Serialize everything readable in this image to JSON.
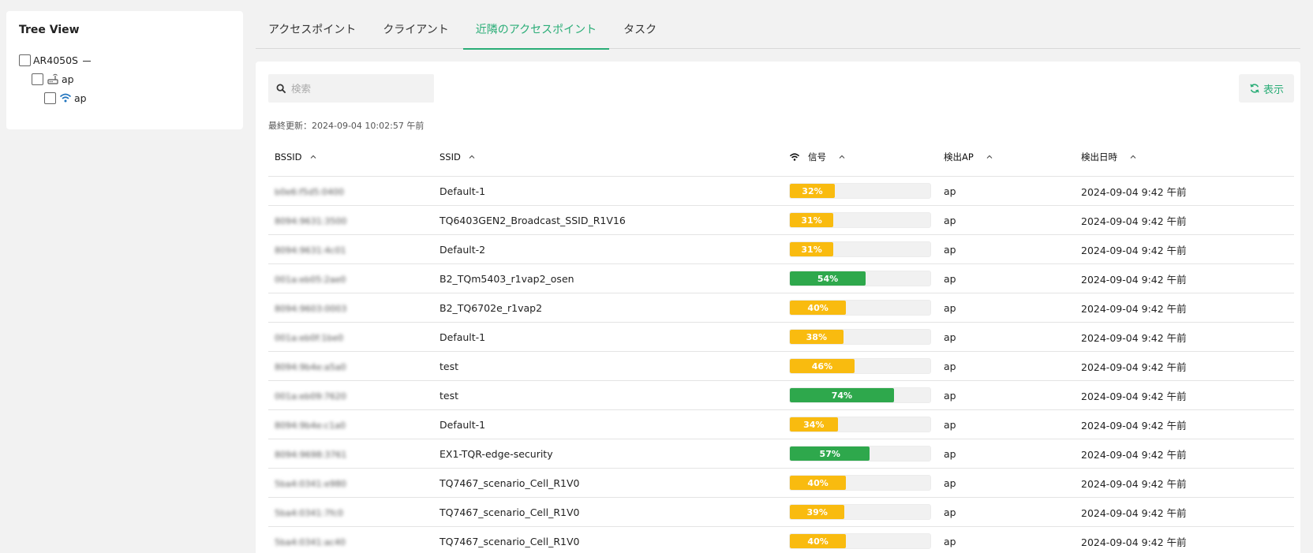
{
  "tree": {
    "title": "Tree View",
    "root_label": "AR4050S",
    "child_label": "ap",
    "leaf_label": "ap"
  },
  "tabs": [
    {
      "label": "アクセスポイント",
      "active": false
    },
    {
      "label": "クライアント",
      "active": false
    },
    {
      "label": "近隣のアクセスポイント",
      "active": true
    },
    {
      "label": "タスク",
      "active": false
    }
  ],
  "search": {
    "placeholder": "検索",
    "value": ""
  },
  "refresh_button": {
    "label": "表示"
  },
  "last_updated": "最終更新：2024-09-04 10:02:57 午前",
  "table": {
    "headers": {
      "bssid": "BSSID",
      "ssid": "SSID",
      "signal": "信号",
      "detected_ap": "検出AP",
      "detected_time": "検出日時"
    },
    "rows": [
      {
        "bssid": "b0e6:f5d5:0400",
        "ssid": "Default-1",
        "signal": 32,
        "signal_label": "32%",
        "ap": "ap",
        "time": "2024-09-04 9:42 午前"
      },
      {
        "bssid": "8094:9631:3500",
        "ssid": "TQ6403GEN2_Broadcast_SSID_R1V16",
        "signal": 31,
        "signal_label": "31%",
        "ap": "ap",
        "time": "2024-09-04 9:42 午前"
      },
      {
        "bssid": "8094:9631:4c01",
        "ssid": "Default-2",
        "signal": 31,
        "signal_label": "31%",
        "ap": "ap",
        "time": "2024-09-04 9:42 午前"
      },
      {
        "bssid": "001a:eb05:2ae0",
        "ssid": "B2_TQm5403_r1vap2_osen",
        "signal": 54,
        "signal_label": "54%",
        "ap": "ap",
        "time": "2024-09-04 9:42 午前"
      },
      {
        "bssid": "8094:9603:0003",
        "ssid": "B2_TQ6702e_r1vap2",
        "signal": 40,
        "signal_label": "40%",
        "ap": "ap",
        "time": "2024-09-04 9:42 午前"
      },
      {
        "bssid": "001a:eb0f:1be0",
        "ssid": "Default-1",
        "signal": 38,
        "signal_label": "38%",
        "ap": "ap",
        "time": "2024-09-04 9:42 午前"
      },
      {
        "bssid": "8094:9b4e:a5a0",
        "ssid": "test",
        "signal": 46,
        "signal_label": "46%",
        "ap": "ap",
        "time": "2024-09-04 9:42 午前"
      },
      {
        "bssid": "001a:eb09:7620",
        "ssid": "test",
        "signal": 74,
        "signal_label": "74%",
        "ap": "ap",
        "time": "2024-09-04 9:42 午前"
      },
      {
        "bssid": "8094:9b4e:c1a0",
        "ssid": "Default-1",
        "signal": 34,
        "signal_label": "34%",
        "ap": "ap",
        "time": "2024-09-04 9:42 午前"
      },
      {
        "bssid": "8094:9698:3761",
        "ssid": "EX1-TQR-edge-security",
        "signal": 57,
        "signal_label": "57%",
        "ap": "ap",
        "time": "2024-09-04 9:42 午前"
      },
      {
        "bssid": "5ba4:0341:e980",
        "ssid": "TQ7467_scenario_Cell_R1V0",
        "signal": 40,
        "signal_label": "40%",
        "ap": "ap",
        "time": "2024-09-04 9:42 午前"
      },
      {
        "bssid": "5ba4:0341:7fc0",
        "ssid": "TQ7467_scenario_Cell_R1V0",
        "signal": 39,
        "signal_label": "39%",
        "ap": "ap",
        "time": "2024-09-04 9:42 午前"
      },
      {
        "bssid": "5ba4:0341:ac40",
        "ssid": "TQ7467_scenario_Cell_R1V0",
        "signal": 40,
        "signal_label": "40%",
        "ap": "ap",
        "time": "2024-09-04 9:42 午前"
      }
    ]
  },
  "colors": {
    "accent": "#2aad77",
    "signal_weak": "#f9bb0f",
    "signal_strong": "#2ea84c"
  },
  "icons": {
    "search": "search-icon",
    "refresh": "refresh-icon",
    "wifi": "wifi-icon",
    "router": "router-icon",
    "sort": "sort-asc-icon"
  }
}
